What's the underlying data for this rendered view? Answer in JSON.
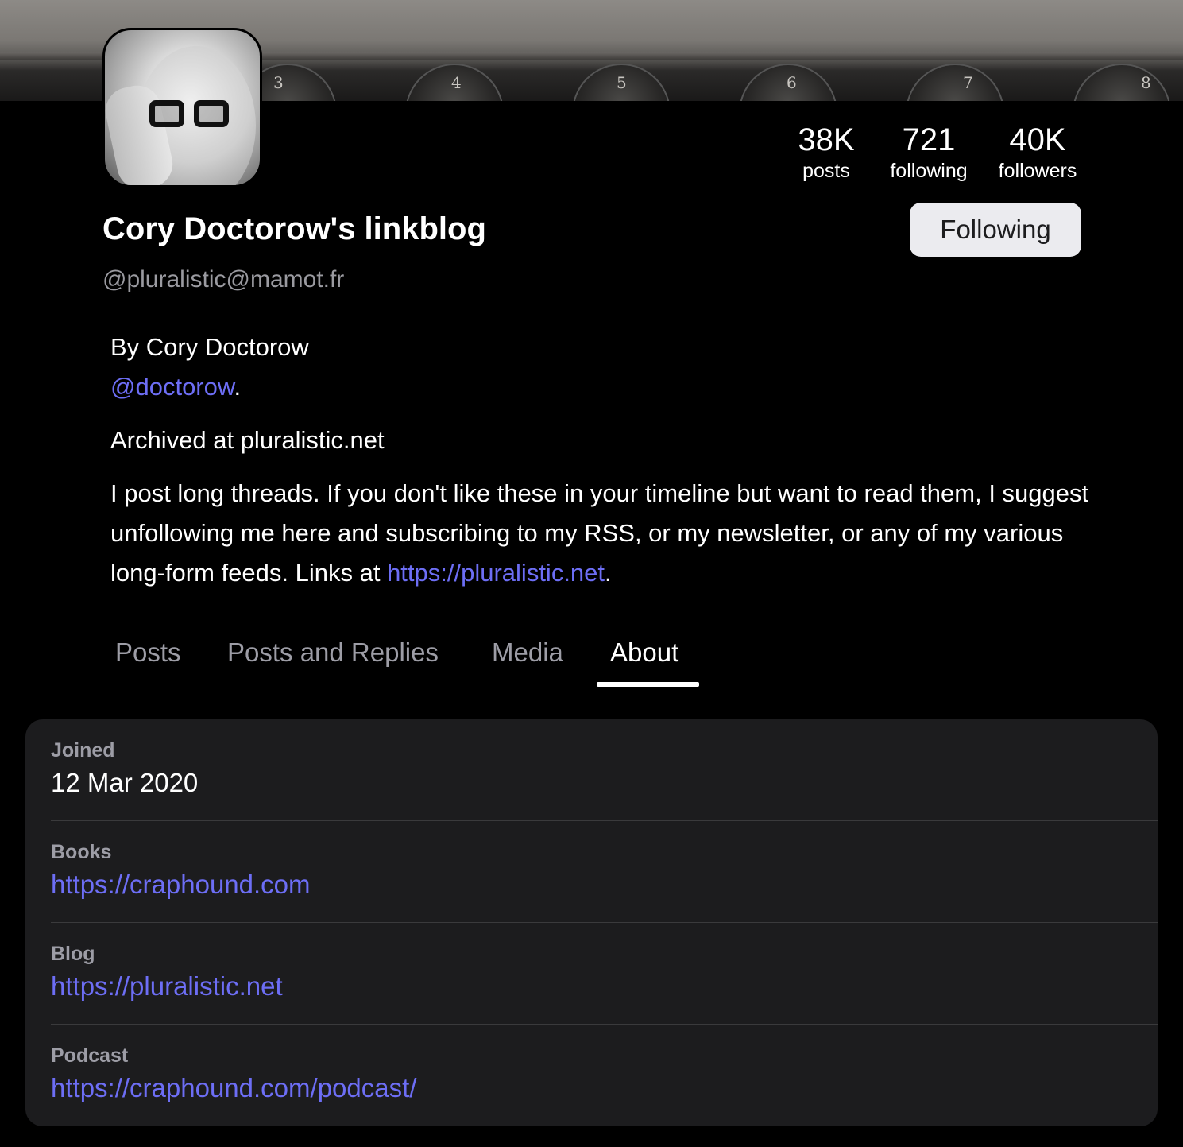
{
  "profile": {
    "display_name": "Cory Doctorow's linkblog",
    "handle": "@pluralistic@mamot.fr",
    "follow_button_label": "Following"
  },
  "stats": {
    "posts": {
      "value": "38K",
      "label": "posts"
    },
    "following": {
      "value": "721",
      "label": "following"
    },
    "followers": {
      "value": "40K",
      "label": "followers"
    }
  },
  "bio": {
    "line1": "By Cory Doctorow",
    "mention": "@doctorow",
    "mention_suffix": ".",
    "line2": "Archived at pluralistic.net",
    "paragraph": "I post long threads. If you don't like these in your timeline but want to read them, I suggest unfollowing me here and subscribing to my RSS, or my newsletter, or any of my various long-form feeds. Links at ",
    "paragraph_link": "https://pluralistic.net",
    "paragraph_suffix": "."
  },
  "tabs": [
    {
      "label": "Posts",
      "active": false
    },
    {
      "label": "Posts and Replies",
      "active": false
    },
    {
      "label": "Media",
      "active": false
    },
    {
      "label": "About",
      "active": true
    }
  ],
  "about": {
    "fields": [
      {
        "label": "Joined",
        "value": "12 Mar 2020",
        "is_link": false
      },
      {
        "label": "Books",
        "value": "https://craphound.com",
        "is_link": true
      },
      {
        "label": "Blog",
        "value": "https://pluralistic.net",
        "is_link": true
      },
      {
        "label": "Podcast",
        "value": "https://craphound.com/podcast/",
        "is_link": true
      }
    ]
  },
  "banner": {
    "dial_numbers": [
      "3",
      "4",
      "5",
      "6",
      "7",
      "8"
    ]
  },
  "colors": {
    "background": "#000000",
    "card": "#1c1c1e",
    "link": "#6d6ef5",
    "muted": "#9d9da6",
    "button_bg": "#ebebef"
  }
}
